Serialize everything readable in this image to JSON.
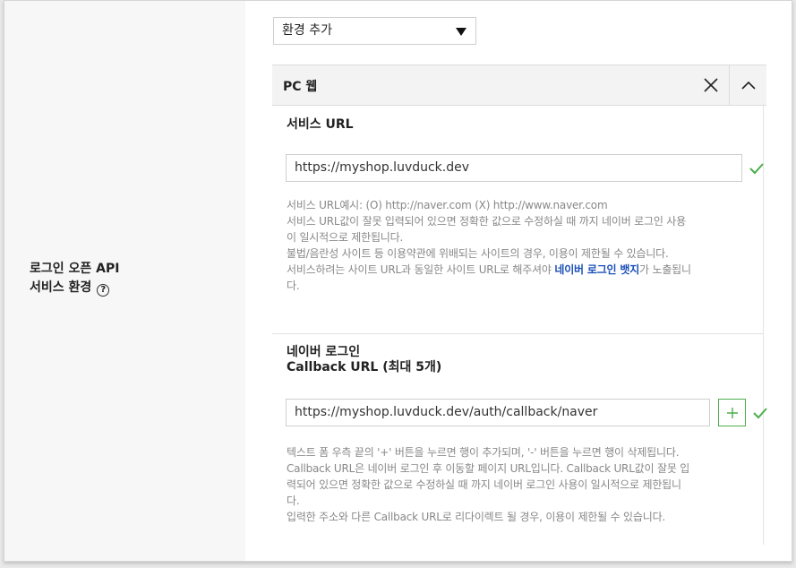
{
  "row_label": {
    "line1": "로그인 오픈 API",
    "line2": "서비스 환경",
    "help_icon": "question-circle-icon"
  },
  "env_select": {
    "value": "환경 추가"
  },
  "panel": {
    "title": "PC 웹",
    "close_icon": "close-icon",
    "collapse_icon": "chevron-up-icon"
  },
  "service_url": {
    "title": "서비스 URL",
    "value": "https://myshop.luvduck.dev",
    "help": [
      "서비스 URL예시: (O) http://naver.com (X) http://www.naver.com",
      "서비스 URL값이 잘못 입력되어 있으면 정확한 값으로 수정하실 때 까지 네이버 로그인 사용",
      "이 일시적으로 제한됩니다.",
      "불법/음란성 사이트 등 이용약관에 위배되는 사이트의 경우, 이용이 제한될 수 있습니다."
    ],
    "help_last_prefix": "서비스하려는 사이트 URL과 동일한 사이트 URL로 해주셔야 ",
    "help_last_link": "네이버 로그인 뱃지",
    "help_last_suffix": "가 노출됩니",
    "help_last_tail": "다."
  },
  "callback_url": {
    "title_line1": "네이버 로그인",
    "title_line2": "Callback URL (최대 5개)",
    "value": "https://myshop.luvduck.dev/auth/callback/naver",
    "add_label": "+",
    "help": [
      "텍스트 폼 우측 끝의 '+' 버튼을 누르면 행이 추가되며, '-' 버튼을 누르면 행이 삭제됩니다.",
      "Callback URL은 네이버 로그인 후 이동할 페이지 URL입니다. Callback URL값이 잘못 입",
      "력되어 있으면 정확한 값으로 수정하실 때 까지 네이버 로그인 사용이 일시적으로 제한됩니",
      "다.",
      "입력한 주소와 다른 Callback URL로 리다이렉트 될 경우, 이용이 제한될 수 있습니다."
    ]
  },
  "colors": {
    "accent_link": "#1a4fb8",
    "check_green": "#4cae4c",
    "left_bg": "#f7f7f7"
  }
}
